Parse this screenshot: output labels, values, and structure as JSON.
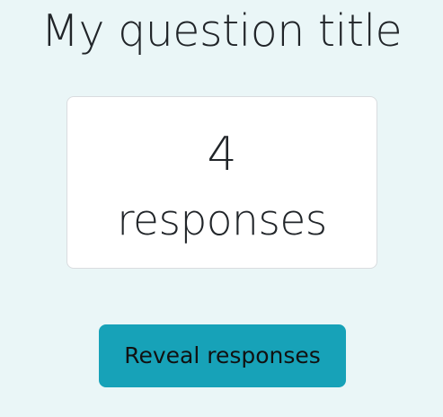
{
  "question": {
    "title": "My question title"
  },
  "responses": {
    "count": "4",
    "label": "responses"
  },
  "actions": {
    "reveal_label": "Reveal responses"
  },
  "colors": {
    "page_background": "#eaf6f7",
    "card_background": "#ffffff",
    "button_background": "#17a2b8"
  }
}
